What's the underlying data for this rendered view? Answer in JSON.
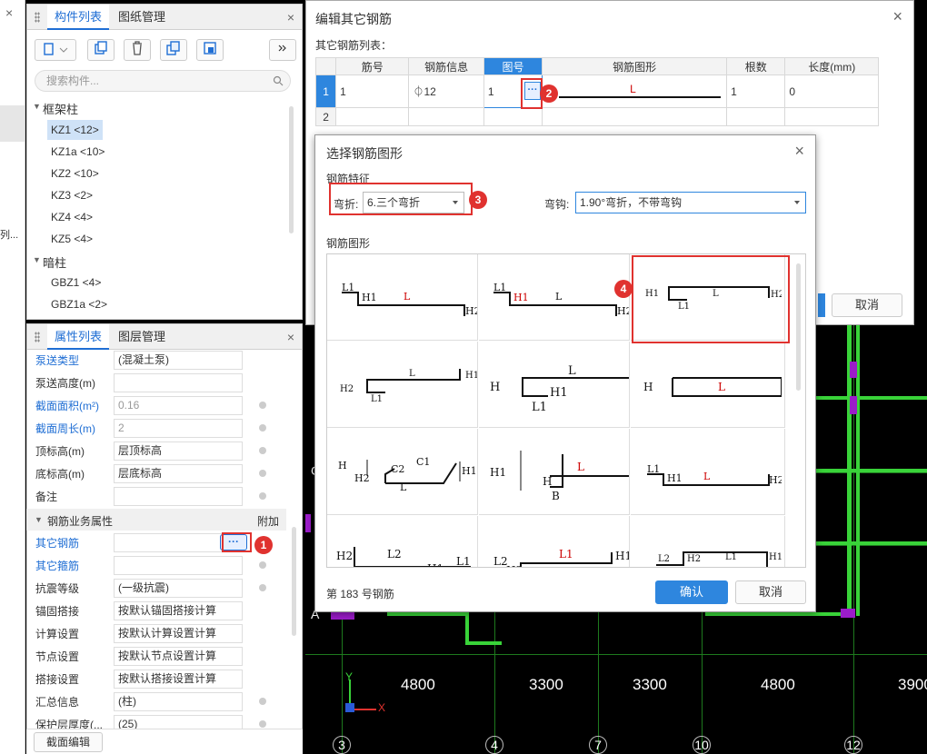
{
  "left_strip": {
    "close": "×",
    "dots": "列..."
  },
  "component_panel": {
    "tabs": [
      "构件列表",
      "图纸管理"
    ],
    "close": "×",
    "search_placeholder": "搜索构件...",
    "group1": "框架柱",
    "items1": [
      "KZ1 <12>",
      "KZ1a <10>",
      "KZ2 <10>",
      "KZ3 <2>",
      "KZ4 <4>",
      "KZ5 <4>"
    ],
    "group2": "暗柱",
    "items2": [
      "GBZ1 <4>",
      "GBZ1a <2>"
    ]
  },
  "property_panel": {
    "tabs": [
      "属性列表",
      "图层管理"
    ],
    "close": "×",
    "rows": [
      {
        "label": "泵送类型",
        "value": "(混凝土泵)",
        "blue": true,
        "dot": false
      },
      {
        "label": "泵送高度(m)",
        "value": "",
        "blue": false,
        "dot": false
      },
      {
        "label": "截面面积(m²)",
        "value": "0.16",
        "blue": true,
        "dot": true
      },
      {
        "label": "截面周长(m)",
        "value": "2",
        "blue": true,
        "dot": true
      },
      {
        "label": "顶标高(m)",
        "value": "层顶标高",
        "blue": false,
        "dot": true
      },
      {
        "label": "底标高(m)",
        "value": "层底标高",
        "blue": false,
        "dot": true
      },
      {
        "label": "备注",
        "value": "",
        "blue": false,
        "dot": true
      }
    ],
    "section": "钢筋业务属性",
    "section_extra": "附加",
    "rows2": [
      {
        "label": "其它钢筋",
        "value": "",
        "blue": true,
        "dot": false
      },
      {
        "label": "其它箍筋",
        "value": "",
        "blue": true,
        "dot": true
      },
      {
        "label": "抗震等级",
        "value": "(一级抗震)",
        "blue": false,
        "dot": true
      },
      {
        "label": "锚固搭接",
        "value": "按默认锚固搭接计算",
        "blue": false,
        "dot": false
      },
      {
        "label": "计算设置",
        "value": "按默认计算设置计算",
        "blue": false,
        "dot": false
      },
      {
        "label": "节点设置",
        "value": "按默认节点设置计算",
        "blue": false,
        "dot": false
      },
      {
        "label": "搭接设置",
        "value": "按默认搭接设置计算",
        "blue": false,
        "dot": false
      },
      {
        "label": "汇总信息",
        "value": "(柱)",
        "blue": false,
        "dot": true
      },
      {
        "label": "保护层厚度(...",
        "value": "(25)",
        "blue": false,
        "dot": true
      }
    ],
    "section_edit_button": "截面编辑",
    "ellipsis": "···"
  },
  "edit_dialog": {
    "title": "编辑其它钢筋",
    "close": "×",
    "list_label": "其它钢筋列表：",
    "columns": [
      "",
      "筋号",
      "钢筋信息",
      "图号",
      "钢筋图形",
      "根数",
      "长度(mm)"
    ],
    "rows": [
      {
        "idx": "1",
        "no": "1",
        "info": "⏀12",
        "fig": "1",
        "shape": "L",
        "count": "1",
        "length": "0"
      },
      {
        "idx": "2",
        "no": "",
        "info": "",
        "fig": "",
        "shape": "",
        "count": "",
        "length": ""
      }
    ],
    "cancel": "取消",
    "ellipsis": "···"
  },
  "shape_dialog": {
    "title": "选择钢筋图形",
    "close": "×",
    "feature_label": "钢筋特征",
    "bend_label": "弯折:",
    "bend_value": "6.三个弯折",
    "hook_label": "弯钩:",
    "hook_value": "1.90°弯折，不带弯钩",
    "shapes_label": "钢筋图形",
    "status": "第 183 号钢筋",
    "confirm": "确认",
    "cancel": "取消"
  },
  "badges": [
    "1",
    "2",
    "3",
    "4"
  ],
  "cad": {
    "dims": [
      "4800",
      "3300",
      "3300",
      "4800",
      "3900"
    ],
    "axes": [
      "3",
      "4",
      "7",
      "10",
      "12"
    ],
    "axis_left": "A",
    "axis_c": "C",
    "ucs_y": "Y",
    "ucs_x": "X"
  },
  "colors": {
    "accent": "#1f6ed4",
    "badge": "#e0322f",
    "grid_green": "#39d339",
    "purple": "#9b1cc9"
  }
}
